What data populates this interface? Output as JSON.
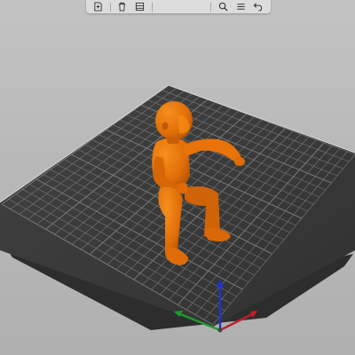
{
  "viewport": {
    "background_color": "#b8b8b8",
    "bed_color": "#3a3a3a",
    "grid_color": "#9a9a9a",
    "model_color": "#e87209",
    "axis_colors": {
      "x": "#c0202a",
      "y": "#1f9a2e",
      "z": "#2233cc"
    }
  },
  "toolbar": {
    "buttons": [
      {
        "name": "add-object-button",
        "icon": "add-file-icon"
      },
      {
        "name": "delete-button",
        "icon": "trash-icon"
      },
      {
        "name": "delete-all-button",
        "icon": "delete-all-icon"
      },
      {
        "name": "search-button",
        "icon": "search-icon"
      },
      {
        "name": "layers-button",
        "icon": "layers-icon"
      },
      {
        "name": "undo-button",
        "icon": "undo-icon"
      }
    ]
  }
}
